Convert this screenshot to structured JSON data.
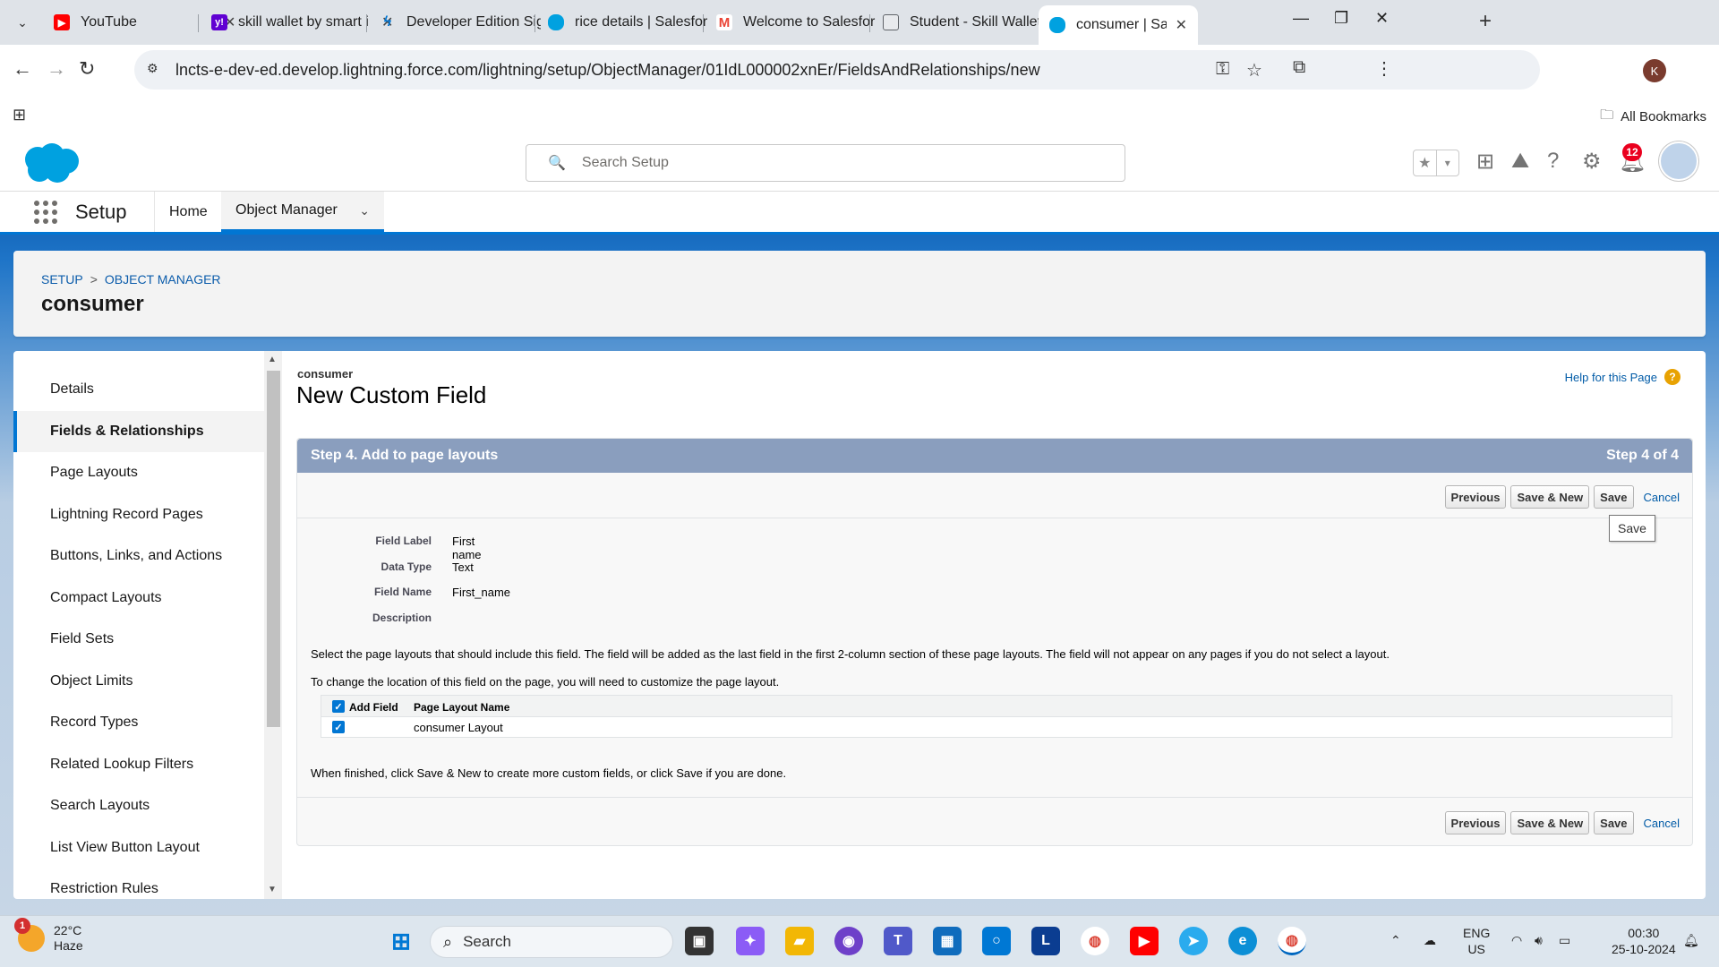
{
  "browser": {
    "tabs": [
      {
        "title": "YouTube",
        "icon": "youtube-icon",
        "color": "#ff0000"
      },
      {
        "title": "skill wallet by smart i",
        "icon": "yahoo-icon",
        "color": "#6001d2"
      },
      {
        "title": "Developer Edition Sig",
        "icon": "bolt-icon",
        "color": "#0176d3"
      },
      {
        "title": "rice details | Salesfor",
        "icon": "salesforce-cloud-icon",
        "color": "#00a1e0"
      },
      {
        "title": "Welcome to Salesfor",
        "icon": "gmail-icon",
        "color": "#ea4335"
      },
      {
        "title": "Student - Skill Wallet",
        "icon": "skillwallet-icon",
        "color": "#5f6368"
      },
      {
        "title": "consumer | Salesforc",
        "icon": "salesforce-cloud-icon",
        "color": "#00a1e0",
        "active": true
      }
    ],
    "url": "lncts-e-dev-ed.develop.lightning.force.com/lightning/setup/ObjectManager/01IdL000002xnEr/FieldsAndRelationships/new",
    "profile_initial": "K",
    "bookmarks_label": "All Bookmarks"
  },
  "sf_header": {
    "search_placeholder": "Search Setup",
    "notification_count": "12",
    "brand_color": "#0176d3"
  },
  "sf_nav": {
    "app_name": "Setup",
    "home_label": "Home",
    "object_manager_label": "Object Manager"
  },
  "object_header": {
    "breadcrumb_setup": "SETUP",
    "breadcrumb_sep": ">",
    "breadcrumb_object_manager": "OBJECT MANAGER",
    "title": "consumer"
  },
  "sidebar": {
    "items": [
      {
        "label": "Details"
      },
      {
        "label": "Fields & Relationships",
        "active": true
      },
      {
        "label": "Page Layouts"
      },
      {
        "label": "Lightning Record Pages"
      },
      {
        "label": "Buttons, Links, and Actions"
      },
      {
        "label": "Compact Layouts"
      },
      {
        "label": "Field Sets"
      },
      {
        "label": "Object Limits"
      },
      {
        "label": "Record Types"
      },
      {
        "label": "Related Lookup Filters"
      },
      {
        "label": "Search Layouts"
      },
      {
        "label": "List View Button Layout"
      },
      {
        "label": "Restriction Rules"
      }
    ]
  },
  "main": {
    "object_label": "consumer",
    "title": "New Custom Field",
    "help_link": "Help for this Page",
    "step_title": "Step 4. Add to page layouts",
    "step_count": "Step 4 of 4",
    "buttons": {
      "previous": "Previous",
      "save_new": "Save & New",
      "save": "Save",
      "cancel": "Cancel"
    },
    "tooltip": "Save",
    "details": {
      "field_label_key": "Field Label",
      "field_label_value": "First name",
      "data_type_key": "Data Type",
      "data_type_value": "Text",
      "field_name_key": "Field Name",
      "field_name_value": "First_name",
      "description_key": "Description",
      "description_value": ""
    },
    "instruction_1": "Select the page layouts that should include this field. The field will be added as the last field in the first 2-column section of these page layouts. The field will not appear on any pages if you do not select a layout.",
    "instruction_2": "To change the location of this field on the page, you will need to customize the page layout.",
    "layout_table": {
      "col_add": "Add Field",
      "col_name": "Page Layout Name",
      "rows": [
        {
          "checked": true,
          "name": "consumer Layout"
        }
      ]
    },
    "finish_text": "When finished, click Save & New to create more custom fields, or click Save if you are done."
  },
  "taskbar": {
    "weather_temp": "22°C",
    "weather_desc": "Haze",
    "weather_badge": "1",
    "search_label": "Search",
    "lang_1": "ENG",
    "lang_2": "US",
    "time": "00:30",
    "date": "25-10-2024"
  }
}
